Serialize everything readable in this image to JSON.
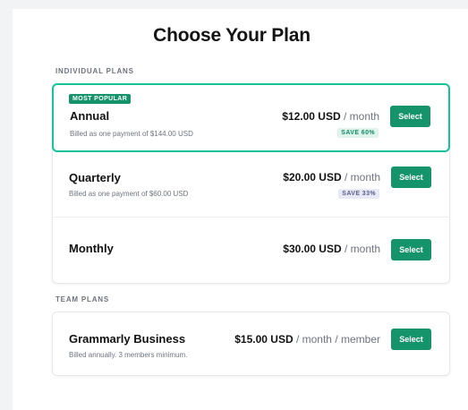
{
  "page": {
    "title": "Choose Your Plan"
  },
  "individual": {
    "section_label": "INDIVIDUAL PLANS",
    "plans": [
      {
        "badge": "MOST POPULAR",
        "name": "Annual",
        "subtitle": "Billed as one payment of $144.00 USD",
        "price": "$12.00 USD",
        "period": " / month",
        "savings": "SAVE 60%",
        "button": "Select"
      },
      {
        "name": "Quarterly",
        "subtitle": "Billed as one payment of $60.00 USD",
        "price": "$20.00 USD",
        "period": " / month",
        "savings": "SAVE 33%",
        "button": "Select"
      },
      {
        "name": "Monthly",
        "price": "$30.00 USD",
        "period": " / month",
        "button": "Select"
      }
    ]
  },
  "team": {
    "section_label": "TEAM PLANS",
    "plans": [
      {
        "name": "Grammarly Business",
        "subtitle": "Billed annually. 3 members minimum.",
        "price": "$15.00 USD",
        "period": " / month / member",
        "button": "Select"
      }
    ]
  },
  "colors": {
    "accent": "#15c39a",
    "button": "#15936b"
  }
}
